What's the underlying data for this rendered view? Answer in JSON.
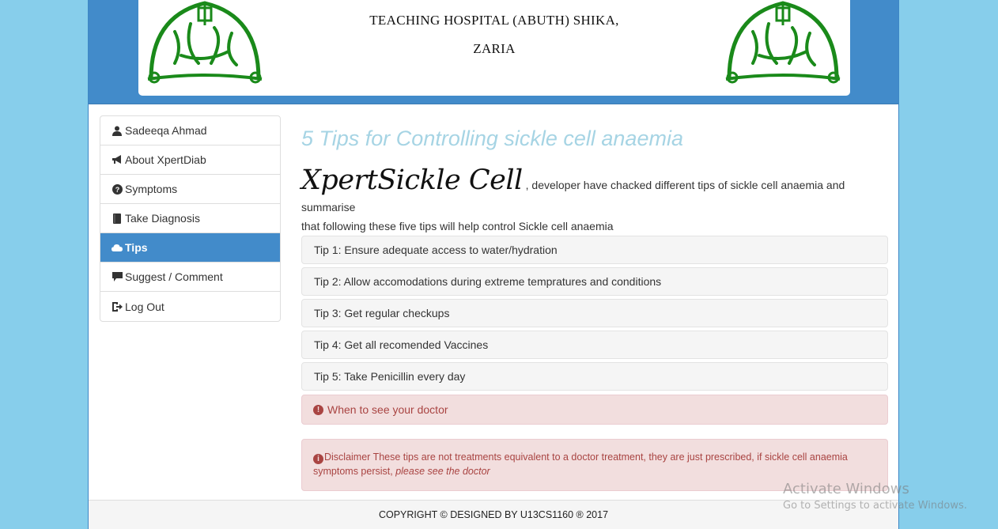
{
  "header": {
    "title_line1": "TEACHING HOSPITAL (ABUTH) SHIKA,",
    "title_line2": "ZARIA",
    "logo_color": "#1a8a1a",
    "bg_color": "#428bca"
  },
  "sidebar": {
    "items": [
      {
        "label": "Sadeeqa Ahmad",
        "icon": "user-icon"
      },
      {
        "label": "About XpertDiab",
        "icon": "bullhorn-icon"
      },
      {
        "label": "Symptoms",
        "icon": "question-sign-icon"
      },
      {
        "label": "Take Diagnosis",
        "icon": "book-icon"
      },
      {
        "label": "Tips",
        "icon": "cloud-icon",
        "active": true
      },
      {
        "label": "Suggest / Comment",
        "icon": "comment-icon"
      },
      {
        "label": "Log Out",
        "icon": "log-out-icon"
      }
    ]
  },
  "main": {
    "title": "5 Tips for Controlling sickle cell anaemia",
    "brand": "XpertSickle Cell",
    "intro_text": " , developer have chacked different tips of sickle cell anaemia and summarise",
    "intro_line2": "that following these five tips will help control Sickle cell anaemia",
    "tips": [
      "Tip 1: Ensure adequate access to water/hydration",
      "Tip 2: Allow accomodations during extreme tempratures and conditions",
      "Tip 3: Get regular checkups",
      "Tip 4: Get all recomended Vaccines",
      "Tip 5: Take Penicillin every day"
    ],
    "when_label": "When to see your doctor",
    "disclaimer_text": "Disclaimer These tips are not treatments equivalent to a doctor treatment, they are just prescribed, if sickle cell anaemia symptoms persist, ",
    "disclaimer_em": "please see the doctor"
  },
  "footer": {
    "text": "COPYRIGHT © DESIGNED BY U13CS1160 ® 2017"
  },
  "watermark": {
    "line1": "Activate Windows",
    "line2": "Go to Settings to activate Windows."
  }
}
